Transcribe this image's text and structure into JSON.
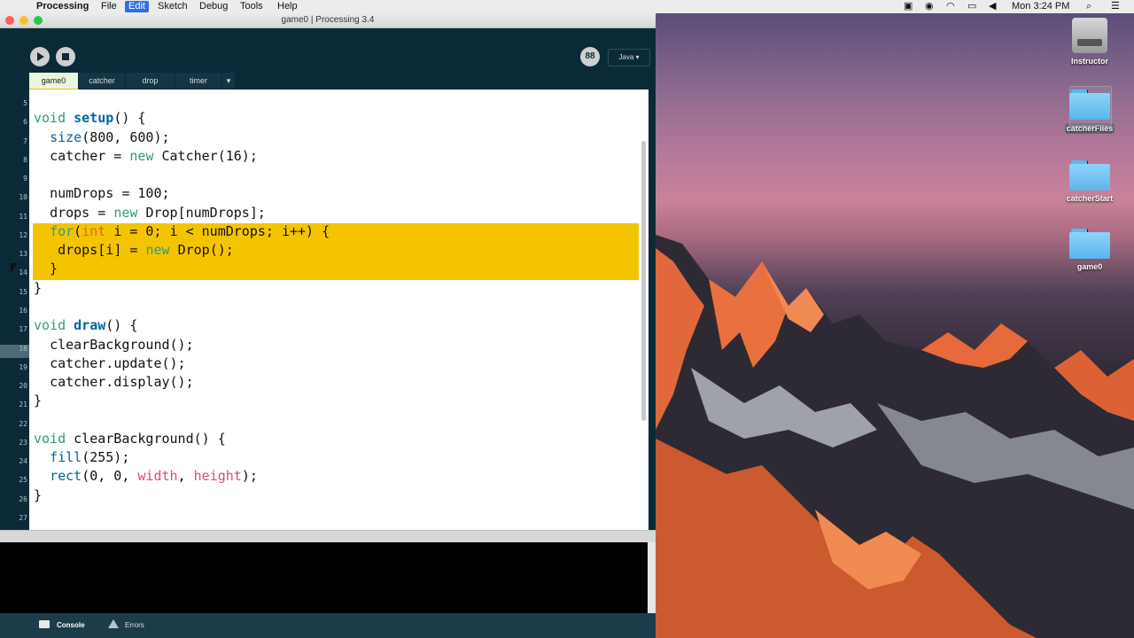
{
  "menubar": {
    "apple": "",
    "app": "Processing",
    "items": [
      "File",
      "Edit",
      "Sketch",
      "Debug",
      "Tools",
      "Help"
    ],
    "selected": "Edit",
    "clock": "Mon 3:24 PM"
  },
  "window": {
    "title": "game0 | Processing 3.4",
    "mode": "Java ▾",
    "debug_label": "88",
    "tabs": [
      "game0",
      "catcher",
      "drop",
      "timer"
    ],
    "tab_menu": "▾",
    "active_tab": "game0"
  },
  "editor": {
    "line_numbers": [
      "5",
      "6",
      "7",
      "8",
      "9",
      "10",
      "11",
      "12",
      "13",
      "14",
      "15",
      "16",
      "17",
      "18",
      "19",
      "20",
      "21",
      "22",
      "23",
      "24",
      "25",
      "26",
      "27"
    ],
    "lines": [
      "",
      "void setup() {",
      "  size(800, 600);",
      "  catcher = new Catcher(16);",
      "",
      "  numDrops = 100;",
      "  drops = new Drop[numDrops];",
      "  for(int i = 0; i < numDrops; i++) {",
      "   drops[i] = new Drop();",
      "  }",
      "}",
      "",
      "void draw() {",
      "  clearBackground();",
      "  catcher.update();",
      "  catcher.display();",
      "}",
      "",
      "void clearBackground() {",
      "  fill(255);",
      "  rect(0, 0, width, height);",
      "}",
      ""
    ],
    "highlight_color": "#f5c400"
  },
  "console_panel": {
    "console_label": "Console",
    "errors_label": "Errors"
  },
  "desktop": {
    "icons": [
      {
        "label": "Instructor",
        "kind": "drive-icon"
      },
      {
        "label": "catcherFiles",
        "kind": "folder-icon",
        "selected": true
      },
      {
        "label": "catcherStart",
        "kind": "folder-icon"
      },
      {
        "label": "game0",
        "kind": "folder-icon"
      }
    ]
  },
  "colors": {
    "accent": "#2f6fde",
    "ide_bg": "#0b2a38",
    "keyword": "#33997e",
    "type": "#e2661a",
    "function": "#006699",
    "builtin_var": "#d94a7a"
  }
}
